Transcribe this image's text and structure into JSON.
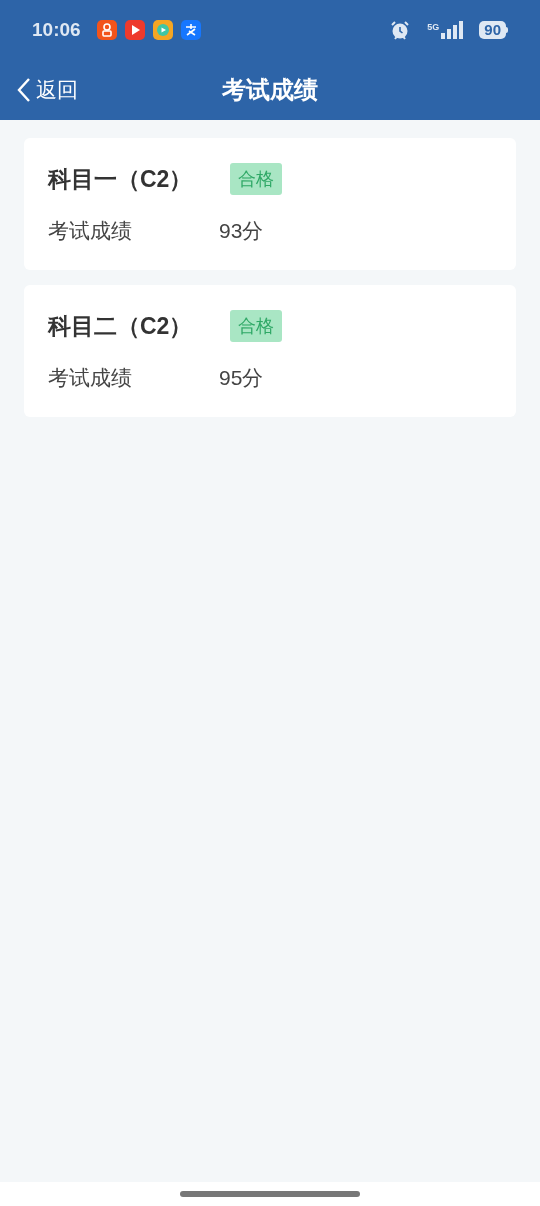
{
  "status_bar": {
    "time": "10:06",
    "network": "5G",
    "battery": "90"
  },
  "nav": {
    "back": "返回",
    "title": "考试成绩"
  },
  "results": [
    {
      "subject": "科目一（C2）",
      "badge": "合格",
      "label": "考试成绩",
      "score": "93分"
    },
    {
      "subject": "科目二（C2）",
      "badge": "合格",
      "label": "考试成绩",
      "score": "95分"
    }
  ]
}
